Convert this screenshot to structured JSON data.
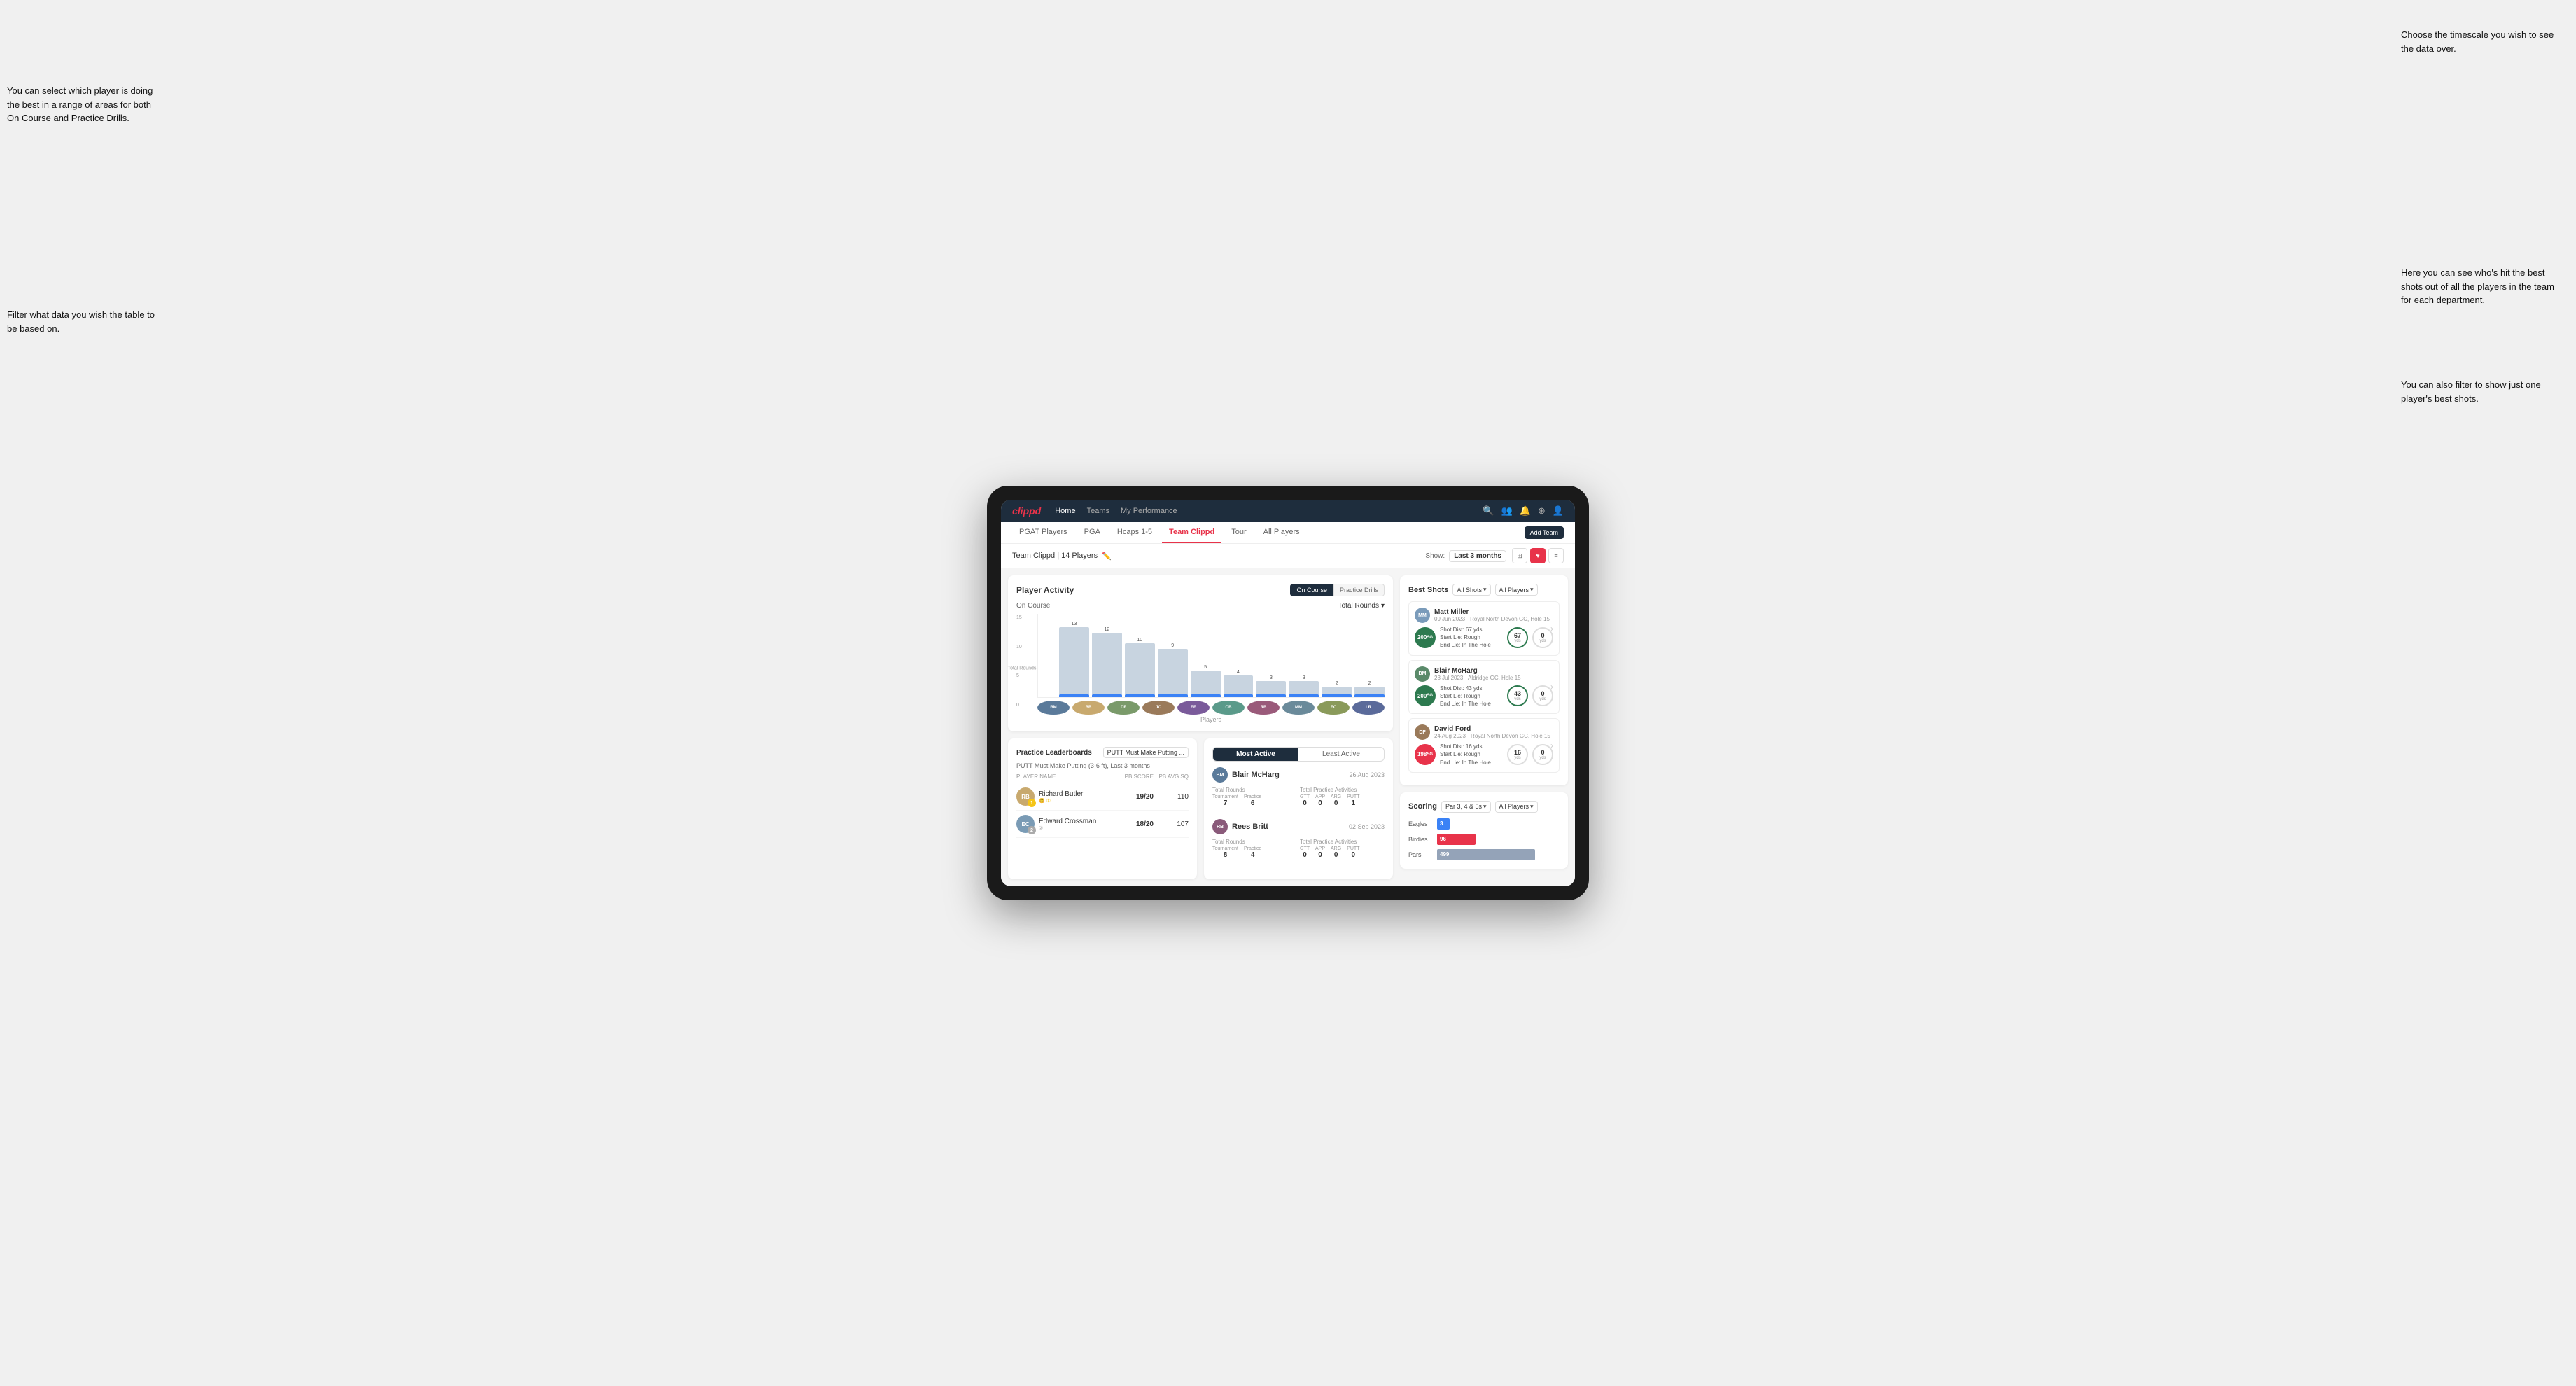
{
  "annotations": {
    "top_right": "Choose the timescale you wish to see the data over.",
    "left_top": "You can select which player is doing the best in a range of areas for both On Course and Practice Drills.",
    "left_bottom": "Filter what data you wish the table to be based on.",
    "right_mid": "Here you can see who's hit the best shots out of all the players in the team for each department.",
    "right_bottom": "You can also filter to show just one player's best shots."
  },
  "nav": {
    "logo": "clippd",
    "links": [
      "Home",
      "Teams",
      "My Performance"
    ],
    "icons": [
      "search",
      "users",
      "bell",
      "circle-plus",
      "user-circle"
    ]
  },
  "tabs": {
    "items": [
      "PGAT Players",
      "PGA",
      "Hcaps 1-5",
      "Team Clippd",
      "Tour",
      "All Players"
    ],
    "active": "Team Clippd",
    "add_button": "Add Team"
  },
  "sub_header": {
    "team_label": "Team Clippd | 14 Players",
    "show_label": "Show:",
    "time_filter": "Last 3 months"
  },
  "player_activity": {
    "title": "Player Activity",
    "toggle_on": "On Course",
    "toggle_practice": "Practice Drills",
    "chart_label": "On Course",
    "chart_dropdown": "Total Rounds",
    "y_axis_label": "Total Rounds",
    "x_axis_label": "Players",
    "bars": [
      {
        "name": "B. McHarg",
        "value": 13,
        "color": "#c8d4e0"
      },
      {
        "name": "B. Britt",
        "value": 12,
        "color": "#c8d4e0"
      },
      {
        "name": "D. Ford",
        "value": 10,
        "color": "#c8d4e0"
      },
      {
        "name": "J. Coles",
        "value": 9,
        "color": "#c8d4e0"
      },
      {
        "name": "E. Ebert",
        "value": 5,
        "color": "#c8d4e0"
      },
      {
        "name": "O. Billingham",
        "value": 4,
        "color": "#c8d4e0"
      },
      {
        "name": "R. Butler",
        "value": 3,
        "color": "#c8d4e0"
      },
      {
        "name": "M. Miller",
        "value": 3,
        "color": "#c8d4e0"
      },
      {
        "name": "E. Crossman",
        "value": 2,
        "color": "#c8d4e0"
      },
      {
        "name": "L. Robertson",
        "value": 2,
        "color": "#c8d4e0"
      }
    ]
  },
  "best_shots": {
    "title": "Best Shots",
    "filter1": "All Shots",
    "filter2": "All Players",
    "shots": [
      {
        "player_name": "Matt Miller",
        "player_detail": "09 Jun 2023 · Royal North Devon GC, Hole 15",
        "badge": "200",
        "badge_type": "green",
        "shot_dist": "67 yds",
        "start_lie": "Rough",
        "end_lie": "In The Hole",
        "stat1_val": "67",
        "stat1_unit": "yds",
        "stat2_val": "0",
        "stat2_unit": "yds"
      },
      {
        "player_name": "Blair McHarg",
        "player_detail": "23 Jul 2023 · Aldridge GC, Hole 15",
        "badge": "200",
        "badge_type": "green",
        "shot_dist": "43 yds",
        "start_lie": "Rough",
        "end_lie": "In The Hole",
        "stat1_val": "43",
        "stat1_unit": "yds",
        "stat2_val": "0",
        "stat2_unit": "yds"
      },
      {
        "player_name": "David Ford",
        "player_detail": "24 Aug 2023 · Royal North Devon GC, Hole 15",
        "badge": "198",
        "badge_type": "red",
        "shot_dist": "16 yds",
        "start_lie": "Rough",
        "end_lie": "In The Hole",
        "stat1_val": "16",
        "stat1_unit": "yds",
        "stat2_val": "0",
        "stat2_unit": "yds"
      }
    ]
  },
  "practice_leaderboards": {
    "title": "Practice Leaderboards",
    "drill_dropdown": "PUTT Must Make Putting ...",
    "subtitle": "PUTT Must Make Putting (3-6 ft), Last 3 months",
    "col_name": "PLAYER NAME",
    "col_score": "PB SCORE",
    "col_avg": "PB AVG SQ",
    "players": [
      {
        "name": "Richard Butler",
        "score": "19/20",
        "avg": "110",
        "rank": 1
      },
      {
        "name": "Edward Crossman",
        "score": "18/20",
        "avg": "107",
        "rank": 2
      }
    ]
  },
  "most_active": {
    "tab_active": "Most Active",
    "tab_least": "Least Active",
    "players": [
      {
        "name": "Blair McHarg",
        "date": "26 Aug 2023",
        "total_rounds_label": "Total Rounds",
        "tournament": 7,
        "practice": 6,
        "total_practice_label": "Total Practice Activities",
        "gtt": 0,
        "app": 0,
        "arg": 0,
        "putt": 1
      },
      {
        "name": "Rees Britt",
        "date": "02 Sep 2023",
        "total_rounds_label": "Total Rounds",
        "tournament": 8,
        "practice": 4,
        "total_practice_label": "Total Practice Activities",
        "gtt": 0,
        "app": 0,
        "arg": 0,
        "putt": 0
      }
    ]
  },
  "scoring": {
    "title": "Scoring",
    "filter1": "Par 3, 4 & 5s",
    "filter2": "All Players",
    "rows": [
      {
        "label": "Eagles",
        "value": 3,
        "max": 500,
        "color": "#3b82f6"
      },
      {
        "label": "Birdies",
        "value": 96,
        "max": 500,
        "color": "#e8334a"
      },
      {
        "label": "Pars",
        "value": 499,
        "max": 500,
        "color": "#94a3b8"
      }
    ]
  }
}
